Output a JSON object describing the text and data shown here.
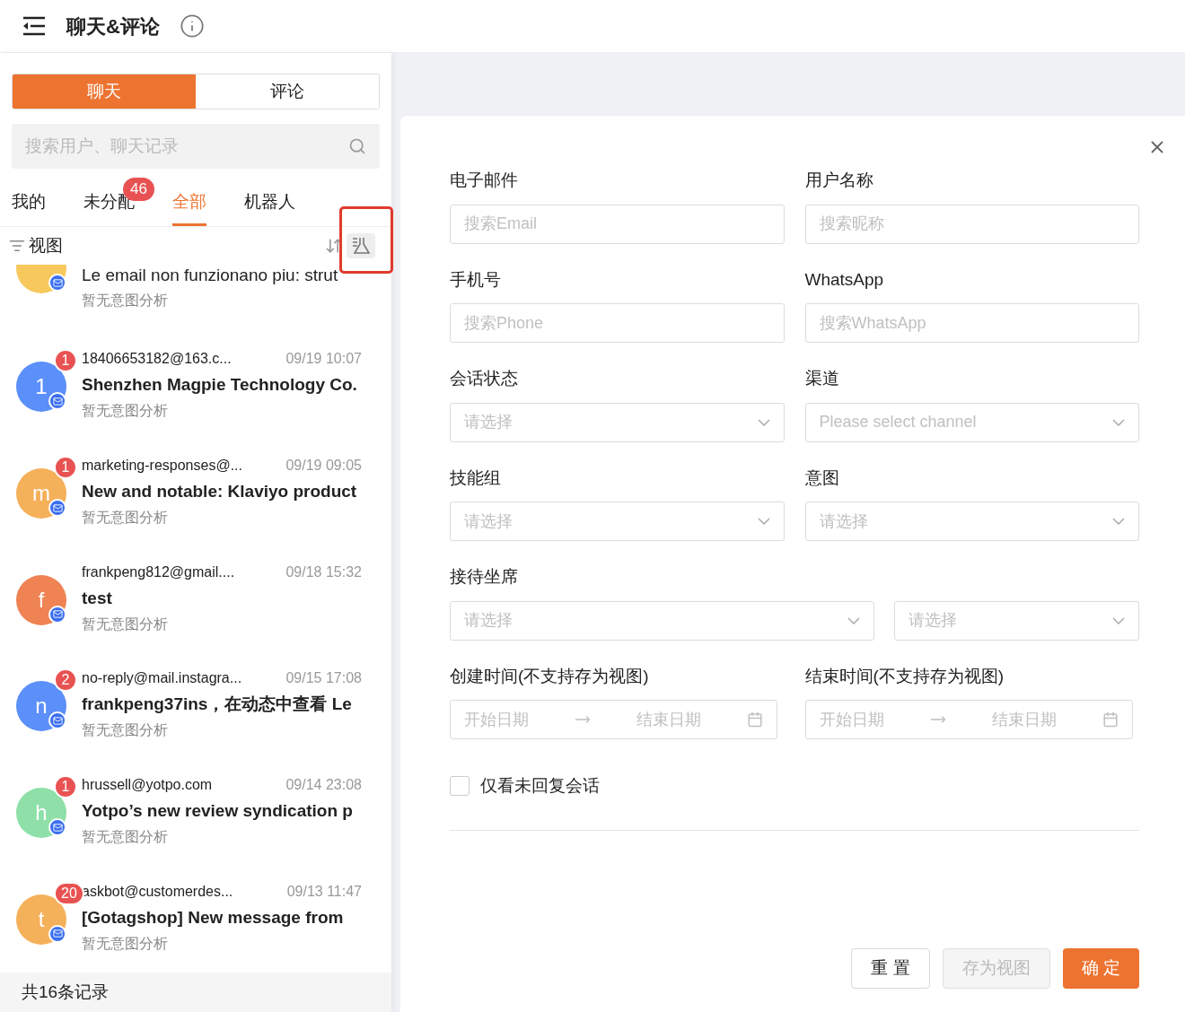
{
  "header": {
    "title": "聊天&评论"
  },
  "segments": [
    {
      "label": "聊天",
      "selected": true
    },
    {
      "label": "评论",
      "selected": false
    }
  ],
  "search": {
    "placeholder": "搜索用户、聊天记录"
  },
  "tabs": [
    {
      "label": "我的",
      "selected": false
    },
    {
      "label": "未分配",
      "selected": false,
      "badge": "46"
    },
    {
      "label": "全部",
      "selected": true
    },
    {
      "label": "机器人",
      "selected": false
    }
  ],
  "view": {
    "label": "视图"
  },
  "conversations": [
    {
      "kind": "partial",
      "color": "#f7c85c",
      "subject": "Le email non funzionano piu: strut",
      "intent": "暂无意图分析"
    },
    {
      "kind": "full",
      "color": "#5b8ff9",
      "letter": "1",
      "unread": "1",
      "sender": "18406653182@163.c...",
      "time": "09/19 10:07",
      "subject": "Shenzhen Magpie Technology Co.",
      "intent": "暂无意图分析"
    },
    {
      "kind": "full",
      "color": "#f5b05a",
      "letter": "m",
      "unread": "1",
      "sender": "marketing-responses@...",
      "time": "09/19 09:05",
      "subject": "New and notable: Klaviyo product",
      "intent": "暂无意图分析"
    },
    {
      "kind": "full",
      "color": "#ef8354",
      "letter": "f",
      "sender": "frankpeng812@gmail....",
      "time": "09/18 15:32",
      "subject": "test",
      "intent": "暂无意图分析"
    },
    {
      "kind": "full",
      "color": "#5b8ff9",
      "letter": "n",
      "unread": "2",
      "sender": "no-reply@mail.instagra...",
      "time": "09/15 17:08",
      "subject": "frankpeng37ins，在动态中查看 Le",
      "intent": "暂无意图分析"
    },
    {
      "kind": "full",
      "color": "#8ee0a8",
      "letter": "h",
      "unread": "1",
      "sender": "hrussell@yotpo.com",
      "time": "09/14 23:08",
      "subject": "Yotpo’s new review syndication p",
      "intent": "暂无意图分析"
    },
    {
      "kind": "full",
      "color": "#f5b05a",
      "letter": "t",
      "unread": "20",
      "sender": "askbot@customerdes...",
      "time": "09/13 11:47",
      "subject": "[Gotagshop] New message from",
      "intent": "暂无意图分析"
    }
  ],
  "footer": {
    "total": "共16条记录"
  },
  "filter": {
    "fields": [
      {
        "kind": "input",
        "label": "电子邮件",
        "placeholder": "搜索Email"
      },
      {
        "kind": "input",
        "label": "用户名称",
        "placeholder": "搜索昵称"
      },
      {
        "kind": "input",
        "label": "手机号",
        "placeholder": "搜索Phone"
      },
      {
        "kind": "input",
        "label": "WhatsApp",
        "placeholder": "搜索WhatsApp"
      },
      {
        "kind": "select",
        "label": "会话状态",
        "placeholder": "请选择"
      },
      {
        "kind": "select",
        "label": "渠道",
        "placeholder": "Please select channel"
      },
      {
        "kind": "select",
        "label": "技能组",
        "placeholder": "请选择"
      },
      {
        "kind": "select",
        "label": "意图",
        "placeholder": "请选择"
      },
      {
        "kind": "double_select",
        "label": "接待坐席",
        "placeholders": [
          "请选择",
          "请选择"
        ]
      },
      {
        "kind": "date_range",
        "label": "创建时间(不支持存为视图)",
        "start": "开始日期",
        "end": "结束日期"
      },
      {
        "kind": "date_range",
        "label": "结束时间(不支持存为视图)",
        "start": "开始日期",
        "end": "结束日期"
      }
    ],
    "unreplied_only": {
      "label": "仅看未回复会话",
      "checked": false
    },
    "buttons": [
      {
        "label": "重 置",
        "kind": "default"
      },
      {
        "label": "存为视图",
        "kind": "disabled"
      },
      {
        "label": "确 定",
        "kind": "primary"
      }
    ]
  }
}
